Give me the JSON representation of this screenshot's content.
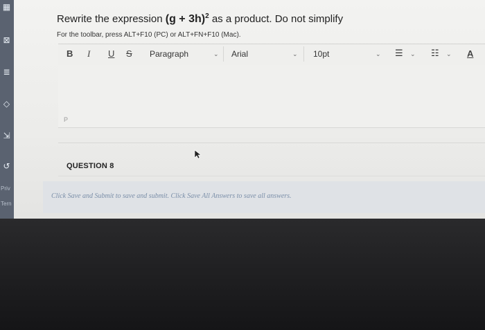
{
  "question": {
    "prefix": "Rewrite the expression",
    "expression": "(g + 3h)",
    "exponent": "2",
    "suffix": "as a product. Do not simplify"
  },
  "hint": "For the toolbar, press ALT+F10 (PC) or ALT+FN+F10 (Mac).",
  "toolbar": {
    "bold": "B",
    "italic": "I",
    "underline": "U",
    "strikethrough": "S",
    "paragraph": "Paragraph",
    "font": "Arial",
    "size": "10pt",
    "text_color": "A"
  },
  "editor": {
    "path": "P"
  },
  "next_question": "QUESTION 8",
  "footer": "Click Save and Submit to save and submit. Click Save All Answers to save all answers.",
  "rail": {
    "label1": "Priv",
    "label2": "Tern"
  },
  "icons": [
    "grid-icon",
    "close-square-icon",
    "list-icon",
    "tag-icon",
    "export-icon",
    "refresh-icon",
    "chevron-down-icon",
    "bulleted-list-icon",
    "numbered-list-icon",
    "arrow-cursor-icon"
  ]
}
